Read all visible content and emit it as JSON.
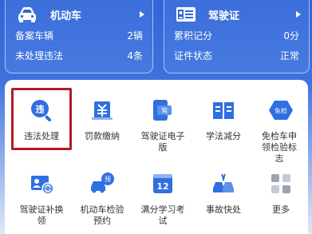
{
  "vehicle_card": {
    "title": "机动车",
    "rows": [
      {
        "label": "备案车辆",
        "value": "2辆"
      },
      {
        "label": "未处理违法",
        "value": "4条"
      }
    ]
  },
  "license_card": {
    "title": "驾驶证",
    "rows": [
      {
        "label": "累积记分",
        "value": "0分"
      },
      {
        "label": "证件状态",
        "value": "正常"
      }
    ]
  },
  "services": [
    {
      "label": "违法处理",
      "icon": "violation-search-icon",
      "icon_text": "违",
      "selected": true
    },
    {
      "label": "罚款缴纳",
      "icon": "fine-payment-icon"
    },
    {
      "label": "驾驶证电子版",
      "icon": "e-license-icon",
      "icon_text": "驾"
    },
    {
      "label": "学法减分",
      "icon": "study-book-icon"
    },
    {
      "label": "免检车申领检验标志",
      "icon": "exempt-inspection-icon",
      "icon_text": "免检"
    },
    {
      "label": "驾驶证补换领",
      "icon": "license-replace-icon"
    },
    {
      "label": "机动车检验预约",
      "icon": "inspection-booking-icon",
      "icon_text": "预"
    },
    {
      "label": "满分学习考试",
      "icon": "full-score-exam-icon",
      "icon_text": "12"
    },
    {
      "label": "事故快处",
      "icon": "accident-icon"
    },
    {
      "label": "更多",
      "icon": "more-grid-icon"
    }
  ],
  "colors": {
    "accent": "#2f6fe0",
    "highlight": "#b01c24"
  }
}
